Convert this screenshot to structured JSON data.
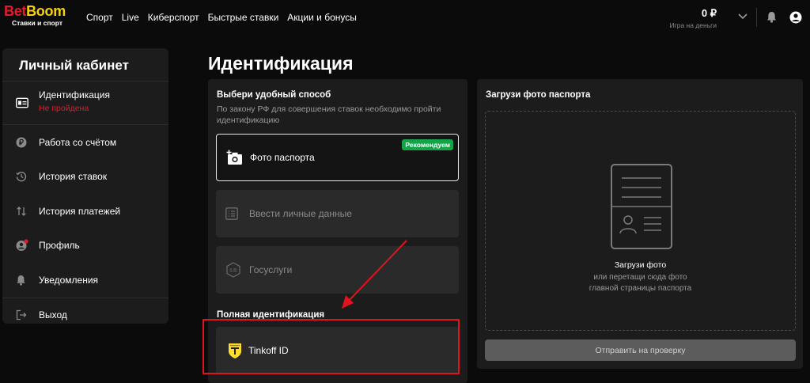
{
  "header": {
    "logo_bet": "Bet",
    "logo_boom": "Boom",
    "logo_sub": "Ставки и спорт",
    "nav": [
      "Спорт",
      "Live",
      "Киберспорт",
      "Быстрые ставки",
      "Акции и бонусы"
    ],
    "balance": "0 ₽",
    "balance_label": "Игра на деньги"
  },
  "sidebar": {
    "title": "Личный кабинет",
    "items": [
      {
        "label": "Идентификация",
        "status": "Не пройдена",
        "icon": "id-card-icon"
      },
      {
        "label": "Работа со счётом",
        "icon": "ruble-icon"
      },
      {
        "label": "История ставок",
        "icon": "history-icon"
      },
      {
        "label": "История платежей",
        "icon": "transfer-icon"
      },
      {
        "label": "Профиль",
        "icon": "profile-icon"
      },
      {
        "label": "Уведомления",
        "icon": "bell-icon"
      },
      {
        "label": "Выход",
        "icon": "logout-icon"
      }
    ]
  },
  "main": {
    "title": "Идентификация",
    "left": {
      "heading": "Выбери удобный способ",
      "subtitle": "По закону РФ для совершения ставок необходимо пройти идентификацию",
      "methods": [
        {
          "label": "Фото паспорта",
          "badge": "Рекомендуем",
          "icon": "camera-add-icon"
        },
        {
          "label": "Ввести личные данные",
          "icon": "form-icon"
        },
        {
          "label": "Госуслуги",
          "icon": "gosuslugi-icon"
        }
      ],
      "full_title": "Полная идентификация",
      "tinkoff": {
        "label": "Tinkoff ID",
        "icon": "tinkoff-icon"
      }
    },
    "right": {
      "heading": "Загрузи фото паспорта",
      "drop_title": "Загрузи фото",
      "drop_sub": "или перетащи сюда фото главной страницы паспорта",
      "submit": "Отправить на проверку"
    }
  },
  "colors": {
    "accent_red": "#e11b2b",
    "accent_yellow": "#f6d20f",
    "badge_green": "#15a34a",
    "panel": "#1c1c1c",
    "background": "#0b0b0b"
  }
}
